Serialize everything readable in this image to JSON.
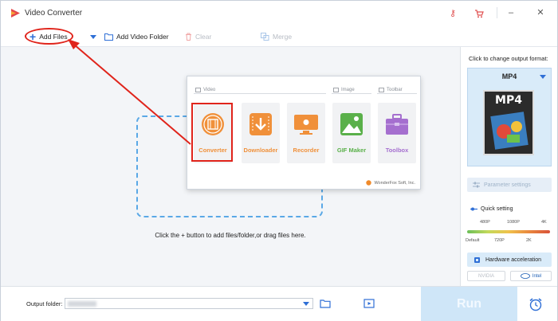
{
  "window": {
    "title": "Video Converter"
  },
  "titlebar_icons": [
    "key-icon",
    "cart-icon"
  ],
  "window_controls": {
    "minimize": "–",
    "close": "✕"
  },
  "toolbar": {
    "add_files": "Add Files",
    "add_video_folder": "Add Video Folder",
    "clear": "Clear",
    "merge": "Merge"
  },
  "popup": {
    "groups": {
      "video": "Video",
      "image": "Image",
      "toolbar": "Toolbar"
    },
    "tools": [
      {
        "label": "Converter",
        "icon": "film-reel-icon",
        "color": "#f0903a"
      },
      {
        "label": "Downloader",
        "icon": "download-icon",
        "color": "#f0903a"
      },
      {
        "label": "Recorder",
        "icon": "screen-record-icon",
        "color": "#f0903a"
      },
      {
        "label": "GIF Maker",
        "icon": "image-icon",
        "color": "#5ab04a"
      },
      {
        "label": "Toolbox",
        "icon": "toolbox-icon",
        "color": "#a56fcf"
      }
    ],
    "brand": "WonderFox Soft, Inc."
  },
  "main": {
    "hint": "Click the + button to add files/folder,or drag files here."
  },
  "right_panel": {
    "title": "Click to change output format:",
    "format": "MP4",
    "format_badge": "MP4",
    "parameter_settings": "Parameter settings",
    "quick_setting": "Quick setting",
    "quality_top": [
      "480P",
      "1080P",
      "4K"
    ],
    "quality_bottom": [
      "Default",
      "720P",
      "2K"
    ],
    "hardware_acceleration": "Hardware acceleration",
    "gpu_nvidia": "NVIDIA",
    "gpu_intel": "Intel"
  },
  "bottom": {
    "output_folder_label": "Output folder:",
    "run": "Run"
  },
  "colors": {
    "accent": "#2f6fd6",
    "highlight": "#e0241b",
    "run_bg": "#cfe6f8"
  }
}
